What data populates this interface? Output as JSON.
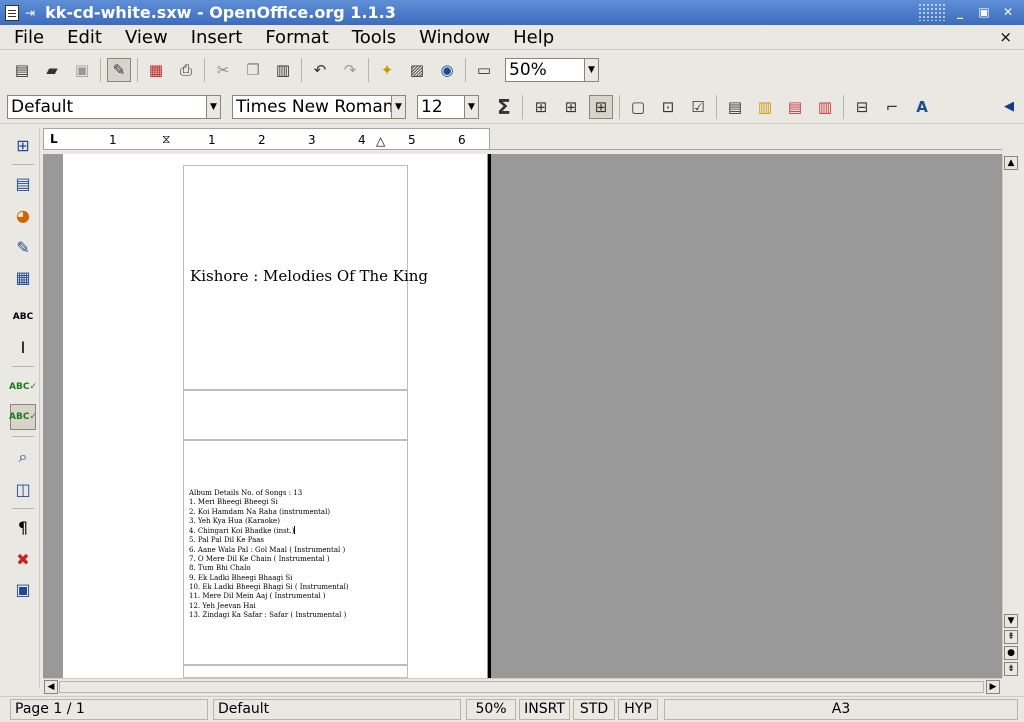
{
  "window": {
    "title": "kk-cd-white.sxw - OpenOffice.org 1.1.3",
    "pin_icon": "pin-icon",
    "buttons": [
      "minimize",
      "maximize",
      "close"
    ]
  },
  "menubar": {
    "items": [
      "File",
      "Edit",
      "View",
      "Insert",
      "Format",
      "Tools",
      "Window",
      "Help"
    ],
    "close_doc": "×"
  },
  "toolbar1": {
    "zoom_value": "50%"
  },
  "toolbar2": {
    "paragraph_style": "Default",
    "font_name": "Times New Roman",
    "font_size": "12",
    "sum_label": "Σ"
  },
  "ruler": {
    "ticks": [
      "1",
      "1",
      "2",
      "3",
      "4",
      "5",
      "6"
    ]
  },
  "document": {
    "cd_title": "Kishore : Melodies Of The King",
    "album_lines": [
      "Album Details No. of Songs : 13",
      "1. Meri Bheegi Bheegi Si",
      "2. Koi Hamdam Na Raha (instrumental)",
      "3. Yeh Kya Hua (Karaoke)",
      "4. Chingari Koi Bhadke (inst.)",
      "5. Pal Pal Dil Ke Paas",
      "6. Aane Wala Pal : Gol Maal ( Instrumental )",
      "7. O Mere Dil Ke Chain ( Instrumental )",
      "8. Tum Bhi Chalo",
      "9. Ek Ladki Bheegi Bhaagi Si",
      "10. Ek Ladki Bheegi Bhagi Si ( Instrumental)",
      "11. Mere Dil Mein Aaj ( Instrumental )",
      "12. Yeh Jeevan Hai",
      "13. Zindagi Ka Safar : Safar ( Instrumental )"
    ]
  },
  "statusbar": {
    "page": "Page 1 / 1",
    "style": "Default",
    "zoom": "50%",
    "insert_mode": "INSRT",
    "selection_mode": "STD",
    "hyperlink_mode": "HYP",
    "paper": "A3"
  },
  "colors": {
    "titlebar": "#3c6cbd",
    "desktop_gray": "#999999",
    "chrome": "#eae8e3"
  }
}
